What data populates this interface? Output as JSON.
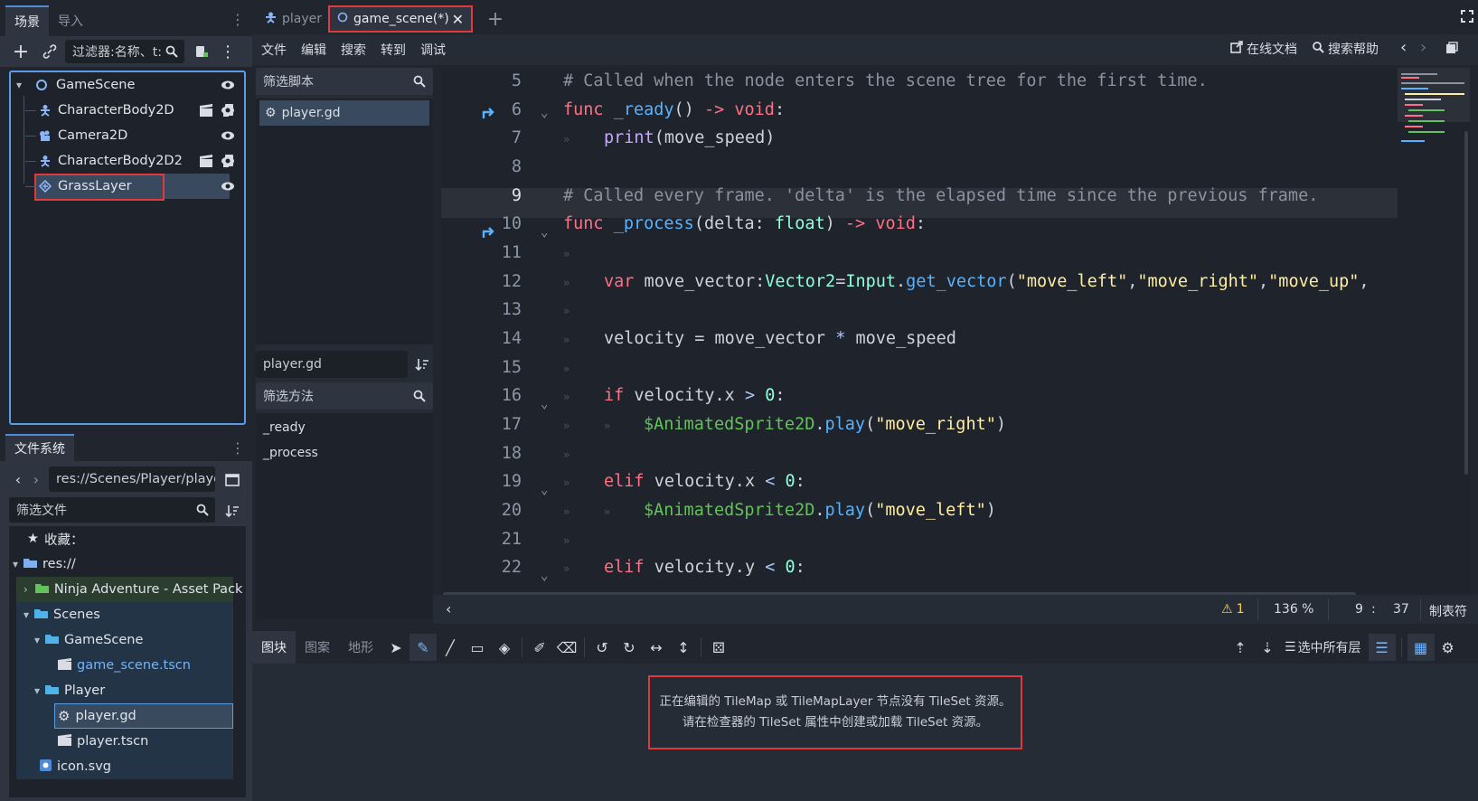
{
  "scene_dock": {
    "tabs": [
      "场景",
      "导入"
    ],
    "filter_placeholder": "过滤器:名称、t:",
    "tree": [
      {
        "label": "GameScene",
        "icon": "node2d-icon"
      },
      {
        "label": "CharacterBody2D",
        "icon": "character-icon"
      },
      {
        "label": "Camera2D",
        "icon": "camera-icon"
      },
      {
        "label": "CharacterBody2D2",
        "icon": "character-icon"
      },
      {
        "label": "GrassLayer",
        "icon": "tilemap-icon"
      }
    ]
  },
  "fs_dock": {
    "tab": "文件系统",
    "path": "res://Scenes/Player/player.",
    "filter_placeholder": "筛选文件",
    "items": [
      {
        "label": "收藏："
      },
      {
        "label": "res://"
      },
      {
        "label": "Ninja Adventure - Asset Pack"
      },
      {
        "label": "Scenes"
      },
      {
        "label": "GameScene"
      },
      {
        "label": "game_scene.tscn"
      },
      {
        "label": "Player"
      },
      {
        "label": "player.gd"
      },
      {
        "label": "player.tscn"
      },
      {
        "label": "icon.svg"
      }
    ]
  },
  "editor_tabs": [
    {
      "label": "player"
    },
    {
      "label": "game_scene(*)"
    }
  ],
  "menu": [
    "文件",
    "编辑",
    "搜索",
    "转到",
    "调试"
  ],
  "top_right": {
    "online_docs": "在线文档",
    "search_help": "搜索帮助"
  },
  "script_list": {
    "filter_placeholder": "筛选脚本",
    "scripts": [
      "player.gd"
    ],
    "current": "player.gd",
    "method_filter_placeholder": "筛选方法",
    "methods": [
      "_ready",
      "_process"
    ]
  },
  "code_lines": [
    {
      "n": "5",
      "text": "# Called when the node enters the scene tree for the first time."
    },
    {
      "n": "6",
      "text": "func _ready() -> void:"
    },
    {
      "n": "7",
      "text": "print(move_speed)"
    },
    {
      "n": "8",
      "text": ""
    },
    {
      "n": "9",
      "text": "# Called every frame. 'delta' is the elapsed time since the previous frame."
    },
    {
      "n": "10",
      "text": "func _process(delta: float) -> void:"
    },
    {
      "n": "11",
      "text": ""
    },
    {
      "n": "12",
      "text": "var move_vector:Vector2=Input.get_vector(\"move_left\",\"move_right\",\"move_up\","
    },
    {
      "n": "13",
      "text": ""
    },
    {
      "n": "14",
      "text": "velocity = move_vector * move_speed"
    },
    {
      "n": "15",
      "text": ""
    },
    {
      "n": "16",
      "text": "if velocity.x > 0:"
    },
    {
      "n": "17",
      "text": "$AnimatedSprite2D.play(\"move_right\")"
    },
    {
      "n": "18",
      "text": ""
    },
    {
      "n": "19",
      "text": "elif velocity.x < 0:"
    },
    {
      "n": "20",
      "text": "$AnimatedSprite2D.play(\"move_left\")"
    },
    {
      "n": "21",
      "text": ""
    },
    {
      "n": "22",
      "text": "elif velocity.y < 0:"
    }
  ],
  "status": {
    "warnings": "1",
    "zoom": "136 %",
    "line": "9",
    "col": "37",
    "indent": "制表符"
  },
  "bottom_panel": {
    "tabs": [
      "图块",
      "图案",
      "地形"
    ],
    "select_all_layers": "选中所有层",
    "message_line1": "正在编辑的 TileMap 或 TileMapLayer 节点没有 TileSet 资源。",
    "message_line2": "请在检查器的 TileSet 属性中创建或加载 TileSet 资源。"
  },
  "colors": {
    "accent": "#5a9ce8",
    "highlight_border": "#e0393e",
    "keyword": "#ff7085",
    "function": "#57b3ff",
    "string": "#ffeda1",
    "comment": "#8a93a0"
  }
}
